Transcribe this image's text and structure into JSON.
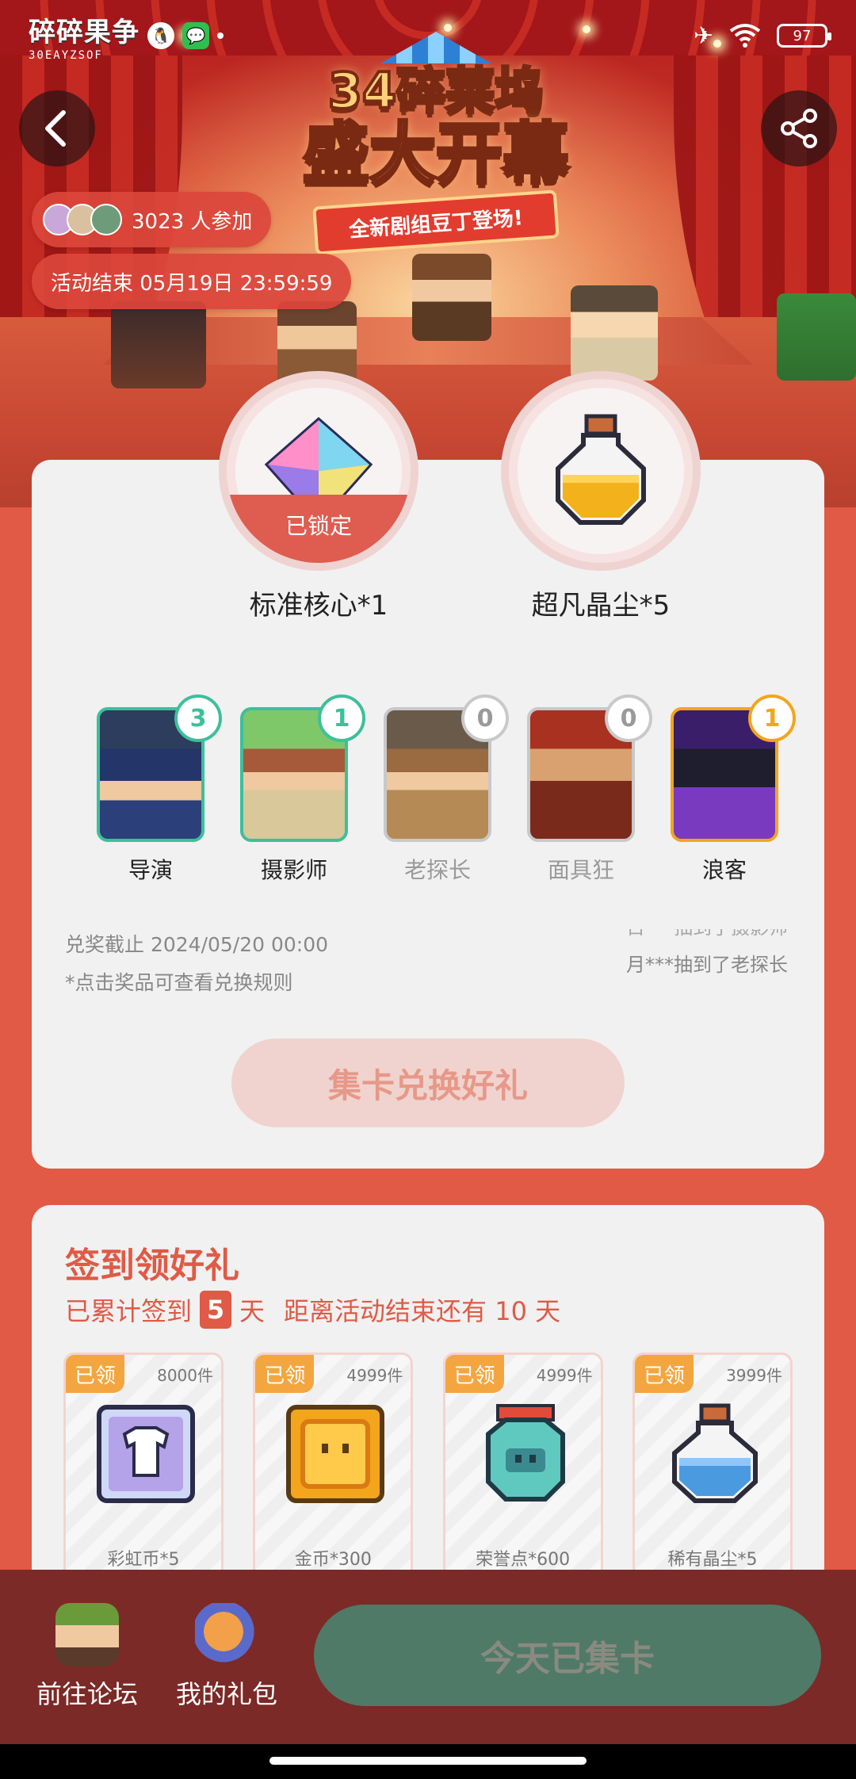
{
  "status_bar": {
    "brand_logo": "碎碎果争",
    "brand_sub": "30EAYZSOF",
    "battery": "97"
  },
  "banner": {
    "title_line1": "34碎莱坞",
    "title_line2": "盛大开幕",
    "subtitle": "全新剧组豆丁登场!"
  },
  "participants": {
    "count_text": "3023 人参加"
  },
  "activity_end": {
    "text": "活动结束 05月19日 23:59:59"
  },
  "rewards": [
    {
      "label": "标准核心*1",
      "status": "已锁定"
    },
    {
      "label": "超凡晶尘*5"
    }
  ],
  "character_cards": [
    {
      "name": "导演",
      "count": "3",
      "style": "green"
    },
    {
      "name": "摄影师",
      "count": "1",
      "style": "green"
    },
    {
      "name": "老探长",
      "count": "0",
      "style": "gray"
    },
    {
      "name": "面具狂",
      "count": "0",
      "style": "gray"
    },
    {
      "name": "浪客",
      "count": "1",
      "style": "gold"
    }
  ],
  "exchange": {
    "deadline": "兑奖截止 2024/05/20 00:00",
    "rule_tip": "*点击奖品可查看兑换规则",
    "ticker_prev": "日***抽到了摄影师",
    "ticker_current": "月***抽到了老探长",
    "collect_button": "集卡兑换好礼"
  },
  "signin": {
    "title": "签到领好礼",
    "progress_prefix": "已累计签到",
    "days": "5",
    "progress_unit": "天",
    "remaining": "距离活动结束还有 10 天",
    "gifts": [
      {
        "tag": "已领",
        "stock": "8000件",
        "name": "彩虹币*5"
      },
      {
        "tag": "已领",
        "stock": "4999件",
        "name": "金币*300"
      },
      {
        "tag": "已领",
        "stock": "4999件",
        "name": "荣誉点*600"
      },
      {
        "tag": "已领",
        "stock": "3999件",
        "name": "稀有晶尘*5"
      }
    ]
  },
  "bottom_bar": {
    "forum_label": "前往论坛",
    "gift_label": "我的礼包",
    "today_button": "今天已集卡"
  },
  "colors": {
    "accent": "#e05a45",
    "green": "#3dbf9a",
    "gold": "#f3a51c",
    "bottom_bar": "#7b2a27",
    "today_button": "#4f7a68"
  }
}
